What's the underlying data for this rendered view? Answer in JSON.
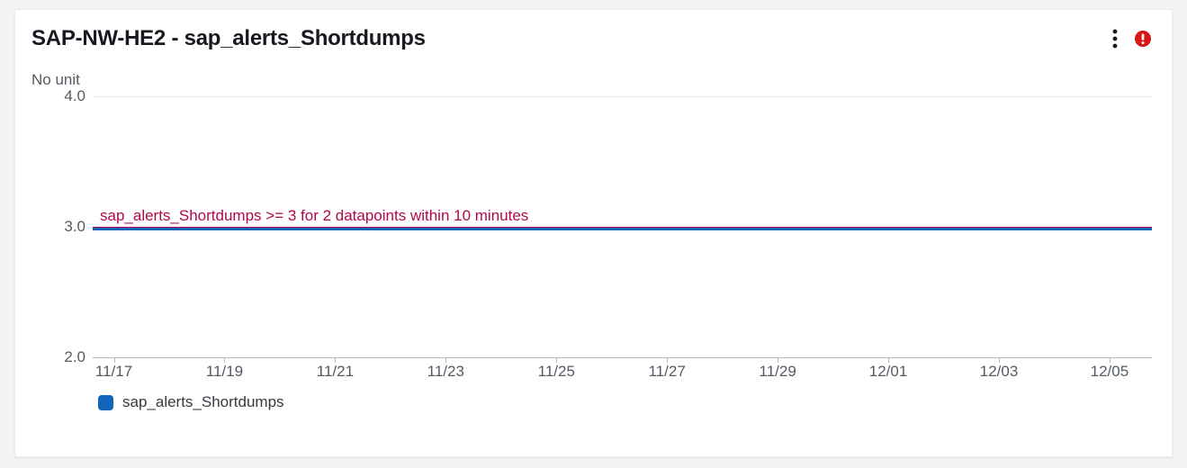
{
  "header": {
    "title": "SAP-NW-HE2 - sap_alerts_Shortdumps",
    "kebab_label": "More options",
    "alert_label": "In alarm"
  },
  "unit_label": "No unit",
  "y_ticks": [
    "4.0",
    "3.0",
    "2.0"
  ],
  "x_ticks": [
    "11/17",
    "11/19",
    "11/21",
    "11/23",
    "11/25",
    "11/27",
    "11/29",
    "12/01",
    "12/03",
    "12/05"
  ],
  "threshold": {
    "label": "sap_alerts_Shortdumps >= 3 for 2 datapoints within 10 minutes",
    "value": 3.0
  },
  "legend": {
    "series_name": "sap_alerts_Shortdumps",
    "color": "#1166bb"
  },
  "colors": {
    "threshold": "#b0084d",
    "series": "#1166bb",
    "alert_badge": "#d91515"
  },
  "chart_data": {
    "type": "line",
    "title": "SAP-NW-HE2 - sap_alerts_Shortdumps",
    "xlabel": "",
    "ylabel": "No unit",
    "ylim": [
      2.0,
      4.0
    ],
    "categories": [
      "11/17",
      "11/19",
      "11/21",
      "11/23",
      "11/25",
      "11/27",
      "11/29",
      "12/01",
      "12/03",
      "12/05"
    ],
    "series": [
      {
        "name": "sap_alerts_Shortdumps",
        "values": [
          3.0,
          3.0,
          3.0,
          3.0,
          3.0,
          3.0,
          3.0,
          3.0,
          3.0,
          3.0
        ]
      }
    ],
    "threshold": {
      "label": "sap_alerts_Shortdumps >= 3 for 2 datapoints within 10 minutes",
      "value": 3.0
    }
  }
}
